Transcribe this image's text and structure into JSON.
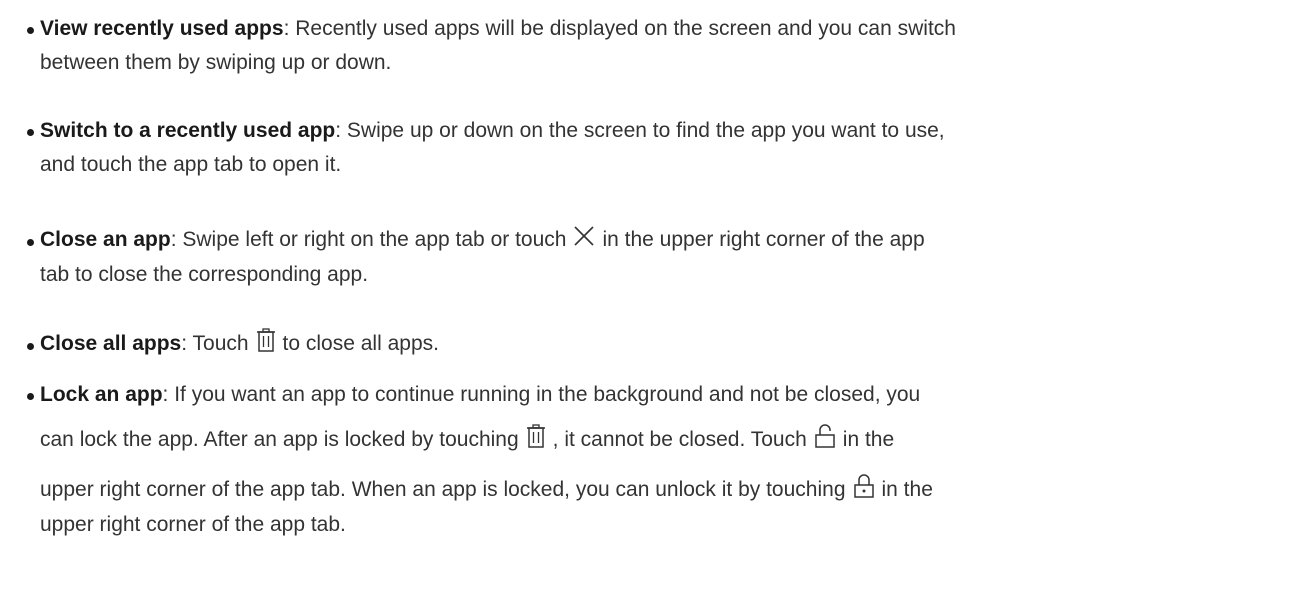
{
  "items": [
    {
      "term": "View recently used apps",
      "line1": ": Recently used apps will be displayed on the screen and you can switch",
      "line2": "between them by swiping up or down."
    },
    {
      "term": "Switch to a recently used app",
      "line1": ": Swipe up or down on the screen to find the app you want to use,",
      "line2": "and touch the app tab to open it."
    },
    {
      "term": "Close an app",
      "line1_a": ": Swipe left or right on the app tab or touch",
      "line1_b": "in the upper right corner of the app",
      "line2": "tab to close the corresponding app.",
      "icon": "close-x-icon"
    },
    {
      "term": "Close all apps",
      "line1_a": ": Touch",
      "line1_b": "to close all apps.",
      "icon": "trash-icon"
    },
    {
      "term": "Lock an app",
      "line1": ": If you want an app to continue running in the background and not be closed, you",
      "line2_a": "can lock the app. After an app is locked by touching",
      "line2_b": ", it cannot be closed. Touch",
      "line2_c": "in the",
      "line3_a": "upper right corner of the app tab. When an app is locked, you can unlock it by touching",
      "line3_b": "in the",
      "line4": "upper right corner of the app tab.",
      "icons": [
        "trash-icon",
        "unlocked-padlock-icon",
        "locked-padlock-icon"
      ]
    }
  ]
}
